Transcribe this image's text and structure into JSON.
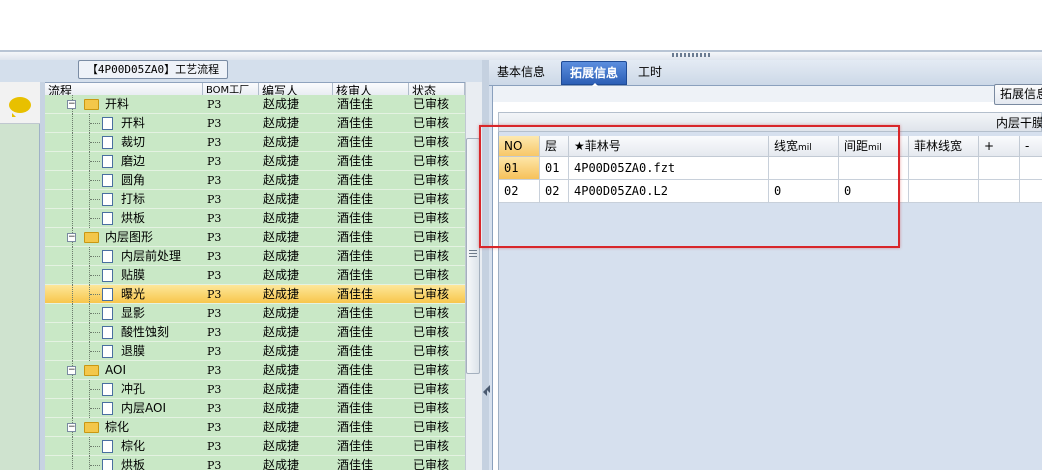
{
  "left_panel": {
    "title": "【4P00D05ZA0】工艺流程",
    "columns": [
      "流程",
      "BOM工厂",
      "编写人",
      "核审人",
      "状态"
    ],
    "rows": [
      {
        "level": 0,
        "type": "folder",
        "expander": "−",
        "name": "开料",
        "bom": "P3",
        "writer": "赵成捷",
        "reviewer": "酒佳佳",
        "status": "已审核"
      },
      {
        "level": 1,
        "type": "doc",
        "name": "开料",
        "bom": "P3",
        "writer": "赵成捷",
        "reviewer": "酒佳佳",
        "status": "已审核"
      },
      {
        "level": 1,
        "type": "doc",
        "name": "裁切",
        "bom": "P3",
        "writer": "赵成捷",
        "reviewer": "酒佳佳",
        "status": "已审核"
      },
      {
        "level": 1,
        "type": "doc",
        "name": "磨边",
        "bom": "P3",
        "writer": "赵成捷",
        "reviewer": "酒佳佳",
        "status": "已审核"
      },
      {
        "level": 1,
        "type": "doc",
        "name": "圆角",
        "bom": "P3",
        "writer": "赵成捷",
        "reviewer": "酒佳佳",
        "status": "已审核"
      },
      {
        "level": 1,
        "type": "doc",
        "name": "打标",
        "bom": "P3",
        "writer": "赵成捷",
        "reviewer": "酒佳佳",
        "status": "已审核"
      },
      {
        "level": 1,
        "type": "doc",
        "name": "烘板",
        "bom": "P3",
        "writer": "赵成捷",
        "reviewer": "酒佳佳",
        "status": "已审核"
      },
      {
        "level": 0,
        "type": "folder",
        "expander": "−",
        "name": "内层图形",
        "bom": "P3",
        "writer": "赵成捷",
        "reviewer": "酒佳佳",
        "status": "已审核"
      },
      {
        "level": 1,
        "type": "doc",
        "name": "内层前处理",
        "bom": "P3",
        "writer": "赵成捷",
        "reviewer": "酒佳佳",
        "status": "已审核"
      },
      {
        "level": 1,
        "type": "doc",
        "name": "贴膜",
        "bom": "P3",
        "writer": "赵成捷",
        "reviewer": "酒佳佳",
        "status": "已审核"
      },
      {
        "level": 1,
        "type": "doc",
        "name": "曝光",
        "bom": "P3",
        "writer": "赵成捷",
        "reviewer": "酒佳佳",
        "status": "已审核",
        "selected": true
      },
      {
        "level": 1,
        "type": "doc",
        "name": "显影",
        "bom": "P3",
        "writer": "赵成捷",
        "reviewer": "酒佳佳",
        "status": "已审核"
      },
      {
        "level": 1,
        "type": "doc",
        "name": "酸性蚀刻",
        "bom": "P3",
        "writer": "赵成捷",
        "reviewer": "酒佳佳",
        "status": "已审核"
      },
      {
        "level": 1,
        "type": "doc",
        "name": "退膜",
        "bom": "P3",
        "writer": "赵成捷",
        "reviewer": "酒佳佳",
        "status": "已审核"
      },
      {
        "level": 0,
        "type": "folder",
        "expander": "−",
        "name": "AOI",
        "bom": "P3",
        "writer": "赵成捷",
        "reviewer": "酒佳佳",
        "status": "已审核"
      },
      {
        "level": 1,
        "type": "doc",
        "name": "冲孔",
        "bom": "P3",
        "writer": "赵成捷",
        "reviewer": "酒佳佳",
        "status": "已审核"
      },
      {
        "level": 1,
        "type": "doc",
        "name": "内层AOI",
        "bom": "P3",
        "writer": "赵成捷",
        "reviewer": "酒佳佳",
        "status": "已审核"
      },
      {
        "level": 0,
        "type": "folder",
        "expander": "−",
        "name": "棕化",
        "bom": "P3",
        "writer": "赵成捷",
        "reviewer": "酒佳佳",
        "status": "已审核"
      },
      {
        "level": 1,
        "type": "doc",
        "name": "棕化",
        "bom": "P3",
        "writer": "赵成捷",
        "reviewer": "酒佳佳",
        "status": "已审核"
      },
      {
        "level": 1,
        "type": "doc",
        "name": "烘板",
        "bom": "P3",
        "writer": "赵成捷",
        "reviewer": "酒佳佳",
        "status": "已审核"
      }
    ]
  },
  "right_panel": {
    "tabs": [
      {
        "label": "基本信息",
        "active": false
      },
      {
        "label": "拓展信息",
        "active": true
      },
      {
        "label": "工时",
        "active": false
      }
    ],
    "expand_button": "拓展信息",
    "inner_layer_label": "内层干膜",
    "grid": {
      "columns": [
        "NO",
        "层",
        "★菲林号",
        "线宽mil",
        "间距mil",
        "菲林线宽",
        "+",
        "-"
      ],
      "rows": [
        {
          "no": "01",
          "layer": "01",
          "film_no": "4P00D05ZA0.fzt",
          "line_width": "",
          "spacing": "",
          "film_line_width": ""
        },
        {
          "no": "02",
          "layer": "02",
          "film_no": "4P00D05ZA0.L2",
          "line_width": "0",
          "spacing": "0",
          "film_line_width": ""
        }
      ]
    }
  },
  "colors": {
    "row_green": "#c9e8c6",
    "row_selected": "#f8c64c",
    "tab_active": "#2c5fb6",
    "highlight_box": "#d8262a"
  }
}
